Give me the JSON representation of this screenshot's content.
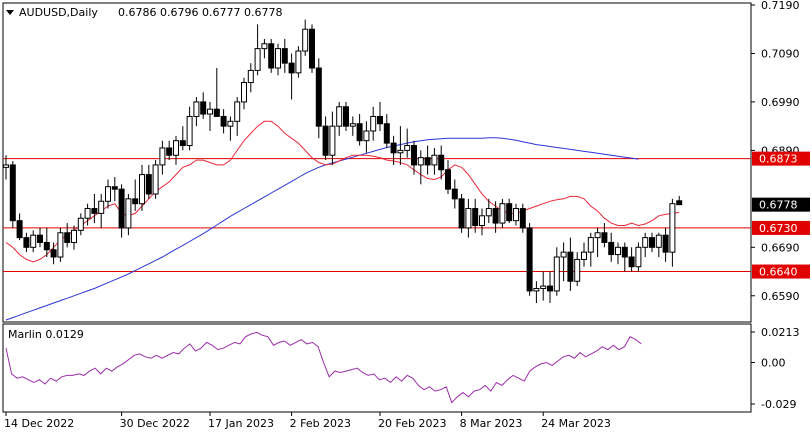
{
  "header": {
    "symbol": "AUDUSD,Daily",
    "ohlc": "0.6786 0.6796 0.6777 0.6778"
  },
  "colors": {
    "bull_candle": "#ffffff",
    "bear_candle": "#000000",
    "ma_fast": "#e8283a",
    "ma_slow": "#2b35d6",
    "level_line": "#e00000",
    "oscillator": "#9b2ea8",
    "axis_text": "#000000",
    "price_tag_bg": "#000000"
  },
  "chart_data": [
    {
      "type": "candlestick",
      "panel": "main",
      "title": "AUDUSD,Daily",
      "subtitle": "0.6786 0.6796 0.6777 0.6778",
      "ylim": [
        0.654,
        0.719
      ],
      "yticks": [
        "0.7190",
        "0.7090",
        "0.6990",
        "0.6890",
        "0.6690",
        "0.6590"
      ],
      "current_price": "0.6778",
      "levels": [
        {
          "value": 0.6873,
          "label": "0.6873"
        },
        {
          "value": 0.673,
          "label": "0.6730"
        },
        {
          "value": 0.664,
          "label": "0.6640"
        }
      ],
      "ohlc": [
        [
          0.6855,
          0.688,
          0.683,
          0.686
        ],
        [
          0.686,
          0.6868,
          0.673,
          0.6745
        ],
        [
          0.6745,
          0.676,
          0.6705,
          0.671
        ],
        [
          0.671,
          0.672,
          0.668,
          0.669
        ],
        [
          0.669,
          0.6725,
          0.668,
          0.6715
        ],
        [
          0.6715,
          0.673,
          0.669,
          0.67
        ],
        [
          0.67,
          0.673,
          0.667,
          0.6685
        ],
        [
          0.6685,
          0.67,
          0.6655,
          0.667
        ],
        [
          0.667,
          0.673,
          0.666,
          0.672
        ],
        [
          0.672,
          0.674,
          0.669,
          0.67
        ],
        [
          0.67,
          0.6735,
          0.6685,
          0.6725
        ],
        [
          0.6725,
          0.676,
          0.6715,
          0.675
        ],
        [
          0.675,
          0.678,
          0.6735,
          0.677
        ],
        [
          0.677,
          0.68,
          0.674,
          0.676
        ],
        [
          0.676,
          0.68,
          0.673,
          0.6785
        ],
        [
          0.6785,
          0.683,
          0.677,
          0.6815
        ],
        [
          0.6815,
          0.6835,
          0.6785,
          0.681
        ],
        [
          0.681,
          0.682,
          0.671,
          0.673
        ],
        [
          0.673,
          0.68,
          0.6715,
          0.679
        ],
        [
          0.679,
          0.683,
          0.6765,
          0.678
        ],
        [
          0.678,
          0.686,
          0.6765,
          0.684
        ],
        [
          0.684,
          0.686,
          0.679,
          0.68
        ],
        [
          0.68,
          0.687,
          0.679,
          0.686
        ],
        [
          0.686,
          0.691,
          0.684,
          0.6895
        ],
        [
          0.6895,
          0.691,
          0.687,
          0.688
        ],
        [
          0.688,
          0.692,
          0.686,
          0.691
        ],
        [
          0.691,
          0.694,
          0.689,
          0.69
        ],
        [
          0.69,
          0.698,
          0.689,
          0.696
        ],
        [
          0.696,
          0.7,
          0.694,
          0.699
        ],
        [
          0.699,
          0.701,
          0.6955,
          0.6965
        ],
        [
          0.6965,
          0.699,
          0.693,
          0.6975
        ],
        [
          0.6975,
          0.706,
          0.696,
          0.696
        ],
        [
          0.696,
          0.6975,
          0.6925,
          0.694
        ],
        [
          0.694,
          0.696,
          0.691,
          0.695
        ],
        [
          0.695,
          0.7,
          0.692,
          0.699
        ],
        [
          0.699,
          0.704,
          0.6975,
          0.703
        ],
        [
          0.703,
          0.707,
          0.701,
          0.7055
        ],
        [
          0.7055,
          0.715,
          0.7045,
          0.71
        ],
        [
          0.71,
          0.712,
          0.708,
          0.711
        ],
        [
          0.711,
          0.712,
          0.705,
          0.706
        ],
        [
          0.706,
          0.711,
          0.7045,
          0.71
        ],
        [
          0.71,
          0.712,
          0.705,
          0.707
        ],
        [
          0.707,
          0.709,
          0.6995,
          0.705
        ],
        [
          0.705,
          0.7105,
          0.704,
          0.7095
        ],
        [
          0.7095,
          0.716,
          0.7085,
          0.714
        ],
        [
          0.714,
          0.715,
          0.705,
          0.706
        ],
        [
          0.706,
          0.708,
          0.6915,
          0.694
        ],
        [
          0.694,
          0.696,
          0.687,
          0.688
        ],
        [
          0.688,
          0.697,
          0.686,
          0.694
        ],
        [
          0.694,
          0.699,
          0.692,
          0.698
        ],
        [
          0.698,
          0.699,
          0.693,
          0.694
        ],
        [
          0.694,
          0.696,
          0.692,
          0.6945
        ],
        [
          0.6945,
          0.6965,
          0.69,
          0.691
        ],
        [
          0.691,
          0.695,
          0.6885,
          0.693
        ],
        [
          0.693,
          0.698,
          0.691,
          0.696
        ],
        [
          0.696,
          0.699,
          0.693,
          0.6945
        ],
        [
          0.6945,
          0.6965,
          0.6895,
          0.6905
        ],
        [
          0.6905,
          0.692,
          0.686,
          0.6885
        ],
        [
          0.6885,
          0.694,
          0.686,
          0.689
        ],
        [
          0.689,
          0.6935,
          0.6875,
          0.69
        ],
        [
          0.69,
          0.691,
          0.684,
          0.686
        ],
        [
          0.686,
          0.689,
          0.682,
          0.6875
        ],
        [
          0.6875,
          0.69,
          0.684,
          0.686
        ],
        [
          0.686,
          0.6895,
          0.684,
          0.688
        ],
        [
          0.688,
          0.69,
          0.683,
          0.685
        ],
        [
          0.685,
          0.687,
          0.68,
          0.681
        ],
        [
          0.681,
          0.683,
          0.677,
          0.679
        ],
        [
          0.679,
          0.68,
          0.672,
          0.673
        ],
        [
          0.673,
          0.679,
          0.671,
          0.677
        ],
        [
          0.677,
          0.679,
          0.672,
          0.6735
        ],
        [
          0.6735,
          0.677,
          0.6715,
          0.6755
        ],
        [
          0.6755,
          0.679,
          0.674,
          0.677
        ],
        [
          0.677,
          0.6785,
          0.672,
          0.674
        ],
        [
          0.674,
          0.679,
          0.673,
          0.678
        ],
        [
          0.678,
          0.679,
          0.674,
          0.6745
        ],
        [
          0.6745,
          0.678,
          0.6735,
          0.677
        ],
        [
          0.677,
          0.678,
          0.672,
          0.673
        ],
        [
          0.673,
          0.674,
          0.659,
          0.66
        ],
        [
          0.66,
          0.662,
          0.6575,
          0.6605
        ],
        [
          0.6605,
          0.664,
          0.658,
          0.661
        ],
        [
          0.661,
          0.664,
          0.6575,
          0.66
        ],
        [
          0.66,
          0.669,
          0.659,
          0.667
        ],
        [
          0.667,
          0.67,
          0.662,
          0.668
        ],
        [
          0.668,
          0.671,
          0.66,
          0.662
        ],
        [
          0.662,
          0.668,
          0.661,
          0.6665
        ],
        [
          0.6665,
          0.67,
          0.665,
          0.668
        ],
        [
          0.668,
          0.672,
          0.665,
          0.671
        ],
        [
          0.671,
          0.673,
          0.667,
          0.672
        ],
        [
          0.672,
          0.674,
          0.669,
          0.67
        ],
        [
          0.67,
          0.672,
          0.666,
          0.6675
        ],
        [
          0.6675,
          0.67,
          0.6655,
          0.669
        ],
        [
          0.669,
          0.67,
          0.664,
          0.667
        ],
        [
          0.667,
          0.669,
          0.664,
          0.665
        ],
        [
          0.665,
          0.67,
          0.664,
          0.669
        ],
        [
          0.669,
          0.672,
          0.667,
          0.671
        ],
        [
          0.671,
          0.672,
          0.668,
          0.669
        ],
        [
          0.669,
          0.672,
          0.667,
          0.6715
        ],
        [
          0.6715,
          0.673,
          0.666,
          0.668
        ],
        [
          0.668,
          0.679,
          0.665,
          0.678
        ],
        [
          0.6786,
          0.6796,
          0.6777,
          0.6778
        ]
      ],
      "ma_fast": [
        0.67,
        0.669,
        0.6675,
        0.6665,
        0.666,
        0.6665,
        0.6675,
        0.669,
        0.6705,
        0.6715,
        0.6725,
        0.6735,
        0.6745,
        0.6755,
        0.6765,
        0.6775,
        0.678,
        0.676,
        0.6755,
        0.676,
        0.6775,
        0.679,
        0.6805,
        0.6815,
        0.6825,
        0.684,
        0.6855,
        0.686,
        0.687,
        0.687,
        0.6865,
        0.686,
        0.686,
        0.687,
        0.689,
        0.691,
        0.6925,
        0.694,
        0.695,
        0.695,
        0.694,
        0.6925,
        0.6915,
        0.6905,
        0.689,
        0.6875,
        0.6865,
        0.686,
        0.6862,
        0.6868,
        0.6875,
        0.688,
        0.688,
        0.688,
        0.6878,
        0.6875,
        0.687,
        0.6868,
        0.6865,
        0.686,
        0.685,
        0.684,
        0.6832,
        0.683,
        0.6835,
        0.685,
        0.686,
        0.6855,
        0.684,
        0.682,
        0.68,
        0.6785,
        0.6775,
        0.6765,
        0.676,
        0.676,
        0.6765,
        0.677,
        0.6775,
        0.678,
        0.6785,
        0.6788,
        0.679,
        0.6795,
        0.6795,
        0.679,
        0.6775,
        0.6765,
        0.675,
        0.674,
        0.6735,
        0.6735,
        0.674,
        0.6735,
        0.6738,
        0.6745,
        0.6755,
        0.6758,
        0.676,
        0.6762
      ],
      "ma_slow": [
        0.654,
        0.6545,
        0.655,
        0.6555,
        0.656,
        0.6565,
        0.657,
        0.6575,
        0.658,
        0.6585,
        0.659,
        0.6595,
        0.66,
        0.6605,
        0.6611,
        0.6617,
        0.6623,
        0.6629,
        0.6635,
        0.6642,
        0.6649,
        0.6656,
        0.6663,
        0.667,
        0.6678,
        0.6686,
        0.6694,
        0.6702,
        0.671,
        0.6718,
        0.6727,
        0.6736,
        0.6745,
        0.6754,
        0.6762,
        0.677,
        0.6778,
        0.6786,
        0.6794,
        0.6802,
        0.681,
        0.6818,
        0.6826,
        0.6834,
        0.6842,
        0.6849,
        0.6855,
        0.686,
        0.6864,
        0.6868,
        0.6872,
        0.6876,
        0.688,
        0.6884,
        0.6888,
        0.6892,
        0.6896,
        0.6899,
        0.6902,
        0.6905,
        0.6908,
        0.691,
        0.6912,
        0.6913,
        0.6914,
        0.6915,
        0.6915,
        0.6915,
        0.6915,
        0.6915,
        0.6915,
        0.6916,
        0.6916,
        0.6915,
        0.6913,
        0.6911,
        0.6908,
        0.6905,
        0.6902,
        0.69,
        0.6898,
        0.6896,
        0.6894,
        0.6892,
        0.689,
        0.6888,
        0.6886,
        0.6884,
        0.6882,
        0.688,
        0.6878,
        0.6876,
        0.6874,
        0.6872
      ]
    },
    {
      "type": "line",
      "panel": "oscillator",
      "title": "Marlin 0.0129",
      "ylim": [
        -0.029,
        0.0213
      ],
      "yticks": [
        "0.0213",
        "0.00",
        "-0.029"
      ],
      "series": [
        {
          "values": [
            0.01,
            -0.008,
            -0.011,
            -0.01,
            -0.012,
            -0.014,
            -0.012,
            -0.015,
            -0.011,
            -0.013,
            -0.01,
            -0.009,
            -0.009,
            -0.008,
            -0.009,
            -0.006,
            -0.004,
            -0.008,
            -0.004,
            -0.006,
            -0.003,
            -0.001,
            0.002,
            0.005,
            0.006,
            0.004,
            0.003,
            0.005,
            0.003,
            0.005,
            0.007,
            0.006,
            0.01,
            0.013,
            0.008,
            0.01,
            0.014,
            0.012,
            0.009,
            0.01,
            0.012,
            0.014,
            0.013,
            0.018,
            0.02,
            0.021,
            0.019,
            0.018,
            0.012,
            0.014,
            0.015,
            0.012,
            0.014,
            0.016,
            0.013,
            0.014,
            0.011,
            0.0,
            -0.01,
            -0.006,
            -0.007,
            -0.006,
            -0.005,
            -0.004,
            -0.007,
            -0.009,
            -0.008,
            -0.012,
            -0.011,
            -0.014,
            -0.01,
            -0.013,
            -0.009,
            -0.011,
            -0.016,
            -0.019,
            -0.017,
            -0.02,
            -0.019,
            -0.017,
            -0.028,
            -0.024,
            -0.021,
            -0.024,
            -0.02,
            -0.019,
            -0.016,
            -0.02,
            -0.014,
            -0.016,
            -0.012,
            -0.009,
            -0.011,
            -0.013,
            -0.006,
            -0.003,
            -0.001,
            0.0,
            -0.002,
            0.001,
            0.004,
            0.005,
            0.003,
            0.007,
            0.004,
            0.006,
            0.008,
            0.011,
            0.009,
            0.012,
            0.009,
            0.011,
            0.018,
            0.016,
            0.013
          ]
        }
      ]
    }
  ],
  "x_axis": {
    "labels": [
      "14 Dec 2022",
      "30 Dec 2022",
      "17 Jan 2023",
      "2 Feb 2023",
      "20 Feb 2023",
      "8 Mar 2023",
      "24 Mar 2023"
    ],
    "label_bars": [
      0,
      17,
      30,
      42,
      55,
      67,
      79
    ]
  }
}
